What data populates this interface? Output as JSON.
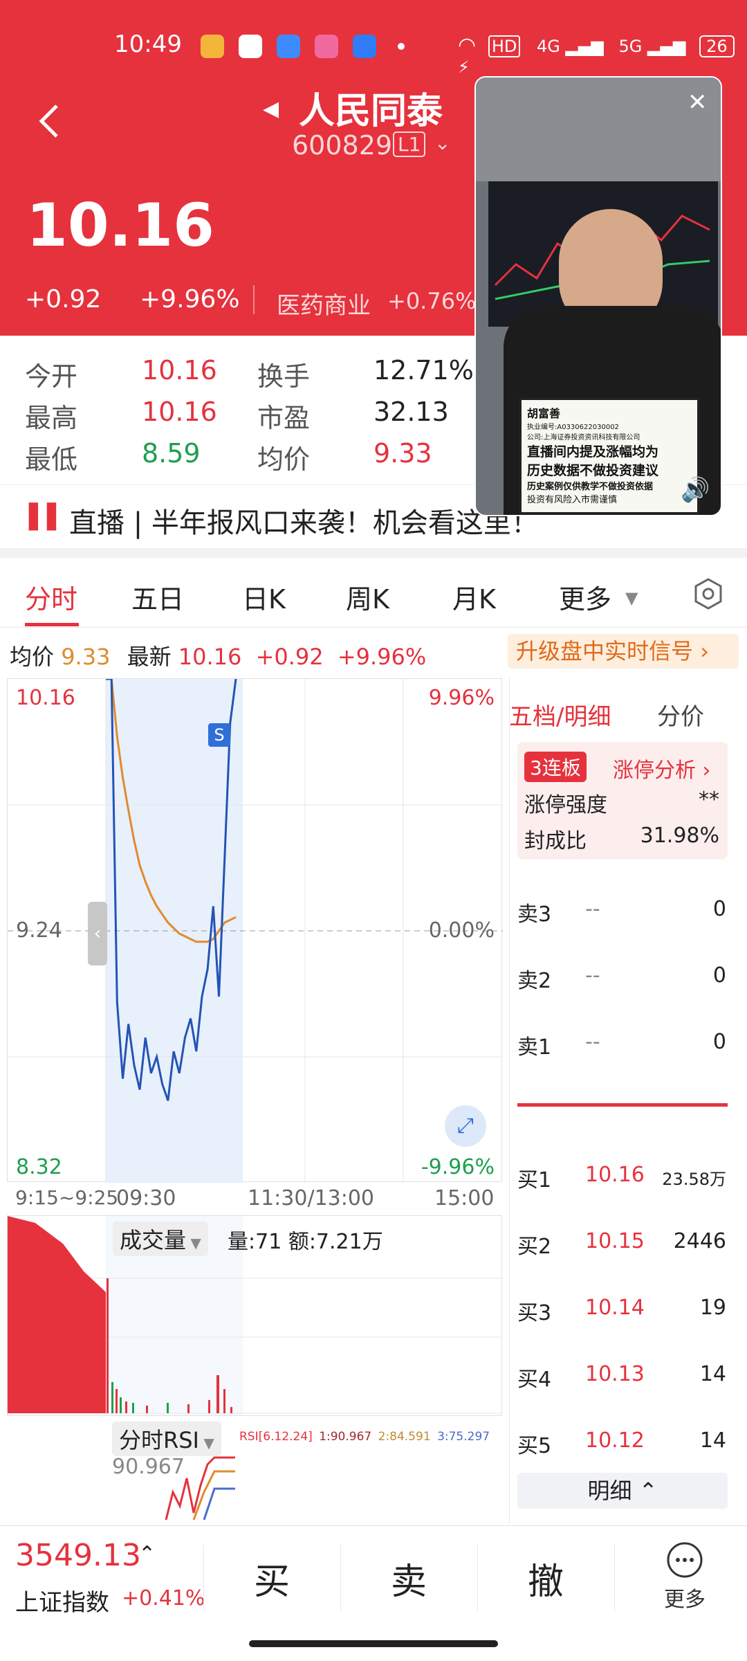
{
  "status_bar": {
    "time": "10:49",
    "badge_hd": "HD",
    "signal_4g": "4G",
    "signal_5g": "5G",
    "battery": "26"
  },
  "header": {
    "title": "人民同泰",
    "code": "600829",
    "level": "L1"
  },
  "price": {
    "last": "10.16",
    "change": "+0.92",
    "change_pct": "+9.96%",
    "sector": "医药商业",
    "sector_pct": "+0.76%"
  },
  "stats": [
    {
      "label": "今开",
      "value": "10.16",
      "label2": "换手",
      "value2": "12.71%"
    },
    {
      "label": "最高",
      "value": "10.16",
      "label2": "市盈",
      "value2": "32.13"
    },
    {
      "label": "最低",
      "value": "8.59",
      "label2": "均价",
      "value2": "9.33"
    }
  ],
  "banner": {
    "text": "直播 | 半年报风口来袭！机会看这里！"
  },
  "live_video": {
    "sign_lines": [
      "胡富善",
      "执业编号:A0330622030002",
      "公司:上海证券投资资讯科技有限公司",
      "直播间内提及涨幅均为",
      "历史数据不做投资建议",
      "历史案例仅供教学不做投资依据",
      "投资有风险入市需谨慎"
    ]
  },
  "tabs": [
    "分时",
    "五日",
    "日K",
    "周K",
    "月K",
    "更多"
  ],
  "info_line": {
    "avg_label": "均价",
    "avg": "9.33",
    "latest_label": "最新",
    "latest": "10.16",
    "chg": "+0.92",
    "pct": "+9.96%",
    "upgrade": "升级盘中实时信号"
  },
  "chart_labels": {
    "top_left": "10.16",
    "top_right": "9.96%",
    "mid_left": "9.24",
    "mid_right": "0.00%",
    "bottom_left": "8.32",
    "bottom_right": "-9.96%",
    "marker": "S",
    "times": [
      "9:15~9:25",
      "09:30",
      "11:30/13:00",
      "15:00"
    ]
  },
  "volume": {
    "label": "成交量",
    "detail": "量:71 额:7.21万"
  },
  "rsi": {
    "label": "分时RSI",
    "params": "RSI[6.12.24]",
    "r1": "1:90.967",
    "r2": "2:84.591",
    "r3": "3:75.297",
    "value": "90.967"
  },
  "chart_data": {
    "type": "line",
    "title": "",
    "ylim": [
      8.32,
      10.16
    ],
    "prev_close": 9.24,
    "series": [
      {
        "name": "最新",
        "color": "#2453b5",
        "values": [
          10.16,
          10.16,
          8.98,
          8.7,
          8.9,
          8.75,
          8.66,
          8.85,
          8.72,
          8.78,
          8.68,
          8.62,
          8.8,
          8.72,
          8.85,
          8.92,
          8.8,
          9.0,
          9.1,
          9.33,
          9.0,
          9.5,
          10.0,
          10.16
        ]
      },
      {
        "name": "均价",
        "color": "#e08a2e",
        "values": [
          10.16,
          10.16,
          9.95,
          9.8,
          9.68,
          9.57,
          9.48,
          9.42,
          9.37,
          9.33,
          9.3,
          9.27,
          9.25,
          9.23,
          9.22,
          9.21,
          9.2,
          9.2,
          9.2,
          9.21,
          9.24,
          9.27,
          9.28,
          9.29
        ]
      }
    ]
  },
  "order_book": {
    "tabs": [
      "五档/明细",
      "分价"
    ],
    "limit_tag": "3连板",
    "limit_analysis": "涨停分析",
    "strength_label": "涨停强度",
    "strength_value": "**",
    "seal_label": "封成比",
    "seal_value": "31.98%",
    "sells": [
      {
        "label": "卖3",
        "price": "--",
        "vol": "0"
      },
      {
        "label": "卖2",
        "price": "--",
        "vol": "0"
      },
      {
        "label": "卖1",
        "price": "--",
        "vol": "0"
      }
    ],
    "buys": [
      {
        "label": "买1",
        "price": "10.16",
        "vol": "23.58万"
      },
      {
        "label": "买2",
        "price": "10.15",
        "vol": "2446"
      },
      {
        "label": "买3",
        "price": "10.14",
        "vol": "19"
      },
      {
        "label": "买4",
        "price": "10.13",
        "vol": "14"
      },
      {
        "label": "买5",
        "price": "10.12",
        "vol": "14"
      }
    ],
    "detail_btn": "明细"
  },
  "bottom": {
    "index_value": "3549.13",
    "index_name": "上证指数",
    "index_pct": "+0.41%",
    "buy": "买",
    "sell": "卖",
    "cancel": "撤",
    "more": "更多"
  }
}
